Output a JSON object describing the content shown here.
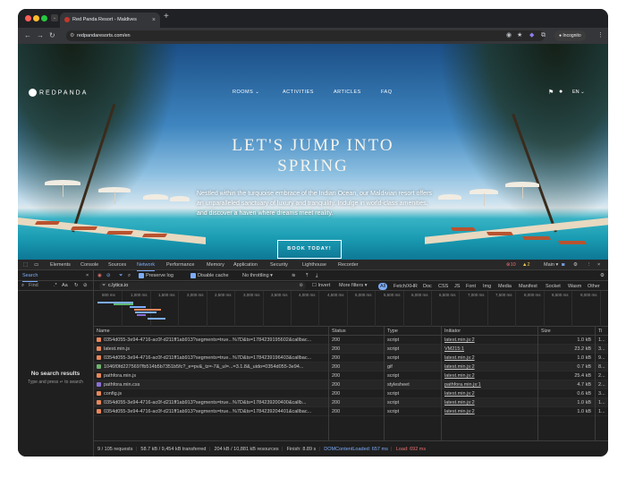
{
  "browser": {
    "tab_title": "Red Panda Resort - Maldives",
    "url": "redpandaresorts.com/en",
    "incognito_label": "Incognito"
  },
  "site": {
    "logo_text": "REDPANDA",
    "nav": [
      "ROOMS",
      "ACTIVITIES",
      "ARTICLES",
      "FAQ"
    ],
    "language": "EN",
    "headline": "LET'S JUMP INTO SPRING",
    "description": "Nestled within the turquoise embrace of the Indian Ocean, our Maldivian resort offers an unparalleled sanctuary of luxury and tranquility. Indulge in world-class amenities, and discover a haven where dreams meet reality.",
    "cta": "BOOK TODAY!"
  },
  "devtools": {
    "tabs": [
      "Elements",
      "Console",
      "Sources",
      "Network",
      "Performance",
      "Memory",
      "Application",
      "Security",
      "Lighthouse",
      "Recorder"
    ],
    "active_tab": "Network",
    "error_count": "10",
    "warning_count": "2",
    "main_label": "Main",
    "sidebar": {
      "tab": "Search",
      "find_label": "Find",
      "aa_label": "Aa",
      "regex_label": ".*",
      "empty_title": "No search results",
      "empty_hint": "Type and press ↵ to search"
    },
    "toolbar": {
      "preserve_log": "Preserve log",
      "disable_cache": "Disable cache",
      "throttling": "No throttling"
    },
    "filter": {
      "value": "c.lytics.io",
      "invert_label": "Invert",
      "more_filters": "More filters",
      "types": [
        "All",
        "Fetch/XHR",
        "Doc",
        "CSS",
        "JS",
        "Font",
        "Img",
        "Media",
        "Manifest",
        "Socket",
        "Wasm",
        "Other"
      ]
    },
    "timeline_ticks": [
      "500 ms",
      "1,000 ms",
      "1,500 ms",
      "2,000 ms",
      "2,500 ms",
      "3,000 ms",
      "3,500 ms",
      "4,000 ms",
      "4,500 ms",
      "5,000 ms",
      "5,500 ms",
      "6,000 ms",
      "6,500 ms",
      "7,000 ms",
      "7,500 ms",
      "8,000 ms",
      "8,500 ms",
      "9,000 ms"
    ],
    "columns": [
      "Name",
      "Status",
      "Type",
      "Initiator",
      "Size",
      "Ti"
    ],
    "rows": [
      {
        "name": "0354d055-3e94-4716-ac0f-d211ff1ab913?segments=true...%7D&ts=1784239195602&callbac...",
        "status": "200",
        "type": "script",
        "initiator": "latest.min.js:2",
        "size": "1.0 kB",
        "time": "1...",
        "icon": "#e8875b"
      },
      {
        "name": "latest.min.js",
        "status": "200",
        "type": "script",
        "initiator": "VM215:1",
        "size": "23.2 kB",
        "time": "3...",
        "icon": "#e8875b"
      },
      {
        "name": "0354d055-3e94-4716-ac0f-d211ff1ab913?segments=true...%7D&ts=1784239196403&callbac...",
        "status": "200",
        "type": "script",
        "initiator": "latest.min.js:2",
        "size": "1.0 kB",
        "time": "9...",
        "icon": "#e8875b"
      },
      {
        "name": "1046f0fd2275697fb514b5b7351b5fc?_e=pv&_tz=-7&_ul=...=3.1.8&_uido=0354d055-3e94...",
        "status": "200",
        "type": "gif",
        "initiator": "latest.min.js:2",
        "size": "0.7 kB",
        "time": "8...",
        "icon": "#6fb46f"
      },
      {
        "name": "pathfora.min.js",
        "status": "200",
        "type": "script",
        "initiator": "latest.min.js:2",
        "size": "25.4 kB",
        "time": "2...",
        "icon": "#e8875b"
      },
      {
        "name": "pathfora.min.css",
        "status": "200",
        "type": "stylesheet",
        "initiator": "pathfora.min.js:1",
        "size": "4.7 kB",
        "time": "2...",
        "icon": "#8a6fd8"
      },
      {
        "name": "config.js",
        "status": "200",
        "type": "script",
        "initiator": "latest.min.js:2",
        "size": "0.6 kB",
        "time": "3...",
        "icon": "#e8875b"
      },
      {
        "name": "0354d055-3e94-4716-ac0f-d211ff1ab913?segments=true...%7D&ts=1784239200400&callb...",
        "status": "200",
        "type": "script",
        "initiator": "latest.min.js:2",
        "size": "1.0 kB",
        "time": "1...",
        "icon": "#e8875b"
      },
      {
        "name": "0354d055-3e94-4716-ac0f-d211ff1ab913?segments=true...%7D&ts=1784239204401&callbac...",
        "status": "200",
        "type": "script",
        "initiator": "latest.min.js:2",
        "size": "1.0 kB",
        "time": "1...",
        "icon": "#e8875b"
      }
    ],
    "status_bar": {
      "requests": "9 / 105 requests",
      "transferred": "58.7 kB / 9,454 kB transferred",
      "resources": "204 kB / 10,881 kB resources",
      "finish": "Finish: 8.89 s",
      "dcl": "DOMContentLoaded: 657 ms",
      "load": "Load: 692 ms"
    }
  }
}
